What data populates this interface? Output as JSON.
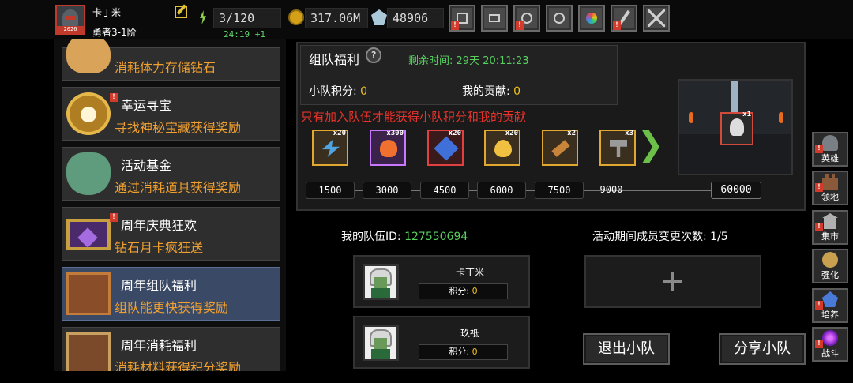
{
  "player": {
    "name": "卡丁米",
    "level_badge": "2026",
    "rank": "勇者3-1阶",
    "energy": "3/120",
    "energy_timer": "24:19 +1",
    "gold": "317.06M",
    "gems": "48906"
  },
  "toolbar": {
    "items": [
      {
        "icon": "shop-cart-icon",
        "badge": "!"
      },
      {
        "icon": "mail-icon",
        "badge": ""
      },
      {
        "icon": "gamepad-icon",
        "badge": "!"
      },
      {
        "icon": "gear-icon",
        "badge": ""
      },
      {
        "icon": "color-wheel-icon",
        "badge": ""
      },
      {
        "icon": "slash-skill-icon",
        "badge": "!"
      },
      {
        "icon": "crossed-swords-icon",
        "badge": ""
      }
    ]
  },
  "events": [
    {
      "title": "",
      "subtitle": "消耗体力存储钻石",
      "icon": "piggy-bank-icon",
      "badge": ""
    },
    {
      "title": "幸运寻宝",
      "subtitle": "寻找神秘宝藏获得奖励",
      "icon": "treasure-medal-icon",
      "badge": "!"
    },
    {
      "title": "活动基金",
      "subtitle": "通过消耗道具获得奖励",
      "icon": "money-bag-icon",
      "badge": ""
    },
    {
      "title": "周年庆典狂欢",
      "subtitle": "钻石月卡疯狂送",
      "icon": "monthly-card-icon",
      "badge": "!"
    },
    {
      "title": "周年组队福利",
      "subtitle": "组队能更快获得奖励",
      "icon": "team-chest-icon",
      "badge": "",
      "selected": true
    },
    {
      "title": "周年消耗福利",
      "subtitle": "消耗材料获得积分奖励",
      "icon": "open-chest-icon",
      "badge": ""
    }
  ],
  "panel": {
    "title": "组队福利",
    "help_label": "?",
    "remaining_label": "剩余时间:",
    "remaining_value": "29天 20:11:23",
    "team_score_label": "小队积分:",
    "team_score_value": "0",
    "my_contrib_label": "我的贡献:",
    "my_contrib_value": "0",
    "notice": "只有加入队伍才能获得小队积分和我的贡献"
  },
  "rewards": [
    {
      "qty": "x20",
      "icon": "lightning-scroll-icon",
      "rarity": "gold"
    },
    {
      "qty": "x300",
      "icon": "flame-orb-icon",
      "rarity": "purple"
    },
    {
      "qty": "x20",
      "icon": "blue-gem-icon",
      "rarity": "red"
    },
    {
      "qty": "x20",
      "icon": "golden-egg-icon",
      "rarity": "gold"
    },
    {
      "qty": "x2",
      "icon": "scroll-icon",
      "rarity": "gold"
    },
    {
      "qty": "x3",
      "icon": "hammer-icon",
      "rarity": "gold"
    }
  ],
  "milestones": [
    "1500",
    "3000",
    "4500",
    "6000",
    "7500",
    "9000"
  ],
  "final_milestone": "60000",
  "preview": {
    "qty": "x1",
    "icon": "boss-skull-icon"
  },
  "team": {
    "id_label": "我的队伍ID:",
    "id_value": "127550694",
    "changes_label": "活动期间成员变更次数:",
    "changes_value": "1/5",
    "members": [
      {
        "name": "卡丁米",
        "score_label": "积分:",
        "score_value": "0"
      },
      {
        "name": "玖祗",
        "score_label": "积分:",
        "score_value": "0"
      }
    ],
    "leave_button": "退出小队",
    "share_button": "分享小队"
  },
  "rightnav": [
    {
      "label": "英雄",
      "icon": "helmet-icon",
      "badge": "!"
    },
    {
      "label": "领地",
      "icon": "castle-icon",
      "badge": "!"
    },
    {
      "label": "集市",
      "icon": "market-icon",
      "badge": "!"
    },
    {
      "label": "强化",
      "icon": "forge-icon",
      "badge": ""
    },
    {
      "label": "培养",
      "icon": "cultivate-icon",
      "badge": "!"
    },
    {
      "label": "战斗",
      "icon": "portal-icon",
      "badge": "!"
    }
  ],
  "colors": {
    "accent_green": "#57d05f",
    "accent_orange": "#f0a030",
    "notice_red": "#e8322a",
    "selected_row": "#3a4a66"
  }
}
